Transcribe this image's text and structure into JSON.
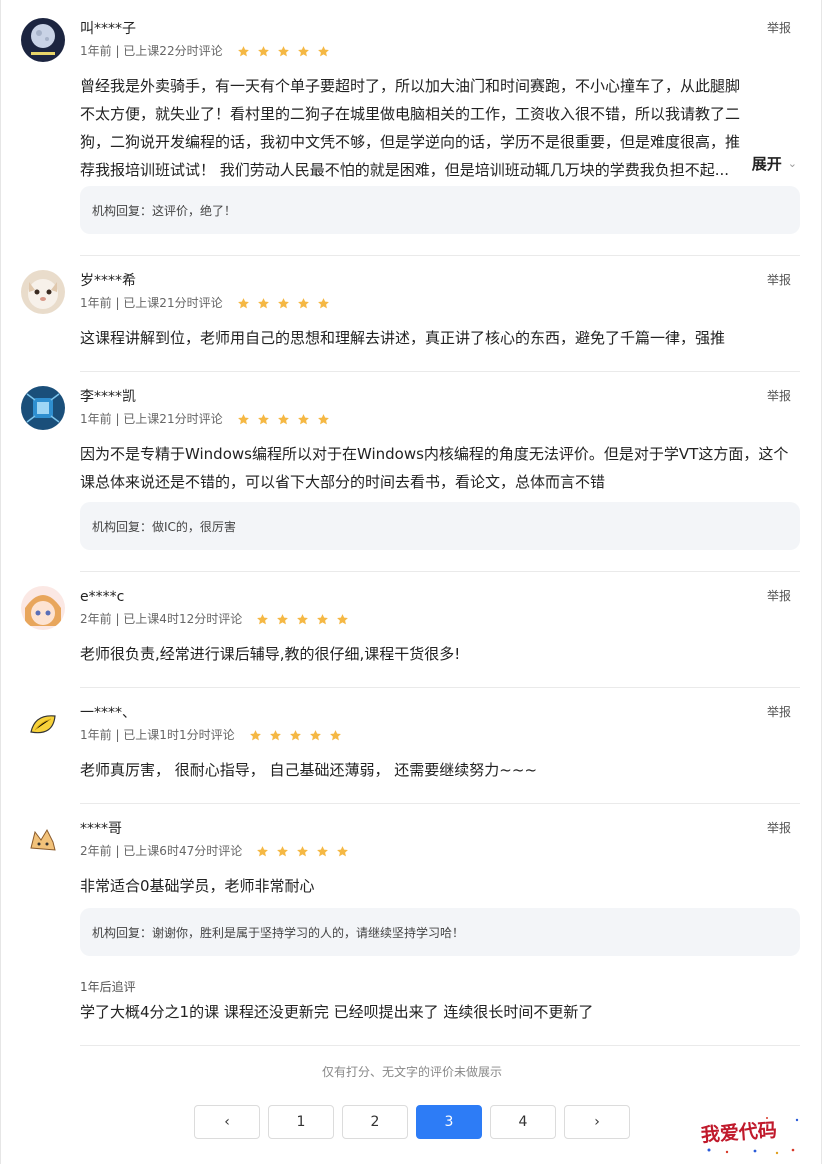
{
  "report_label": "举报",
  "reviews": [
    {
      "user": "叫****子",
      "meta": "1年前 | 已上课22分时评论",
      "rating": 5,
      "content": "曾经我是外卖骑手，有一天有个单子要超时了，所以加大油门和时间赛跑，不小心撞车了，从此腿脚不太方便，就失业了！看村里的二狗子在城里做电脑相关的工作，工资收入很不错，所以我请教了二狗，二狗说开发编程的话，我初中文凭不够，但是学逆向的话，学历不是很重要，但是难度很高，推荐我报培训班试试！ 我们劳动人民最不怕的就是困难，但是培训班动辄几万块的学费我负担不起...",
      "expand_label": "展开",
      "reply": "机构回复：这评价，绝了！"
    },
    {
      "user": "岁****希",
      "meta": "1年前 | 已上课21分时评论",
      "rating": 5,
      "content": "这课程讲解到位，老师用自己的思想和理解去讲述，真正讲了核心的东西，避免了千篇一律，强推"
    },
    {
      "user": "李****凯",
      "meta": "1年前 | 已上课21分时评论",
      "rating": 5,
      "content": "因为不是专精于Windows编程所以对于在Windows内核编程的角度无法评价。但是对于学VT这方面，这个课总体来说还是不错的，可以省下大部分的时间去看书，看论文，总体而言不错",
      "reply": "机构回复：做IC的，很厉害"
    },
    {
      "user": "e****c",
      "meta": "2年前 | 已上课4时12分时评论",
      "rating": 5,
      "content": "老师很负责,经常进行课后辅导,教的很仔细,课程干货很多!"
    },
    {
      "user": "一****、",
      "meta": "1年前 | 已上课1时1分时评论",
      "rating": 5,
      "content": "老师真厉害， 很耐心指导， 自己基础还薄弱， 还需要继续努力~~~"
    },
    {
      "user": "****哥",
      "meta": "2年前 | 已上课6时47分时评论",
      "rating": 5,
      "content": "非常适合0基础学员，老师非常耐心",
      "reply": "机构回复：谢谢你，胜利是属于坚持学习的人的，请继续坚持学习哈！",
      "followup_label": "1年后追评",
      "followup": "学了大概4分之1的课 课程还没更新完 已经呗提出来了 连续很长时间不更新了"
    }
  ],
  "footer_note": "仅有打分、无文字的评价未做展示",
  "pagination": {
    "prev": "‹",
    "next": "›",
    "pages": [
      "1",
      "2",
      "3",
      "4"
    ],
    "current": "3"
  },
  "watermark": "我爱代码",
  "colors": {
    "star": "#f5b844",
    "active_page": "#2d7cf6",
    "reply_bg": "#f3f5f8"
  }
}
